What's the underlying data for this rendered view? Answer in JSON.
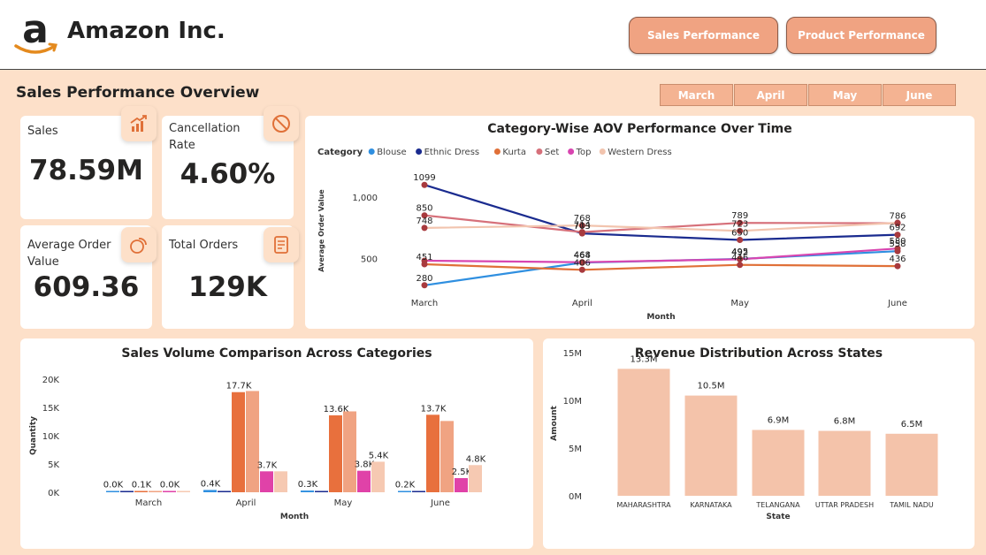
{
  "header": {
    "brand": "Amazon Inc.",
    "logo_icon": "amazon-a-logo",
    "nav": [
      "Sales Performance",
      "Product Performance"
    ]
  },
  "page": {
    "title": "Sales Performance Overview",
    "months": [
      "March",
      "April",
      "May",
      "June"
    ]
  },
  "kpis": [
    {
      "label": "Sales",
      "value": "78.59M",
      "icon": "growth-chart-icon"
    },
    {
      "label": "Cancellation Rate",
      "value": "4.60%",
      "icon": "prohibited-icon"
    },
    {
      "label": "Average Order Value",
      "value": "609.36",
      "icon": "coins-icon"
    },
    {
      "label": "Total Orders",
      "value": "129K",
      "icon": "receipt-icon"
    }
  ],
  "colors": {
    "Blouse": "#2f8fe0",
    "Ethnic Dress": "#1a2b8f",
    "Kurta": "#e07038",
    "Set": "#d6707a",
    "Top": "#d845b0",
    "Western Dress": "#f2c4ae",
    "point": "#a83a3e",
    "state_bar": "#f4c3aa",
    "vol_Kurta": "#e8703d",
    "vol_Set": "#f0a382",
    "vol_Top": "#e042a8",
    "vol_Western": "#f6c9b2"
  },
  "chart_data": [
    {
      "type": "line",
      "title": "Category-Wise AOV Performance Over Time",
      "legend_title": "Category",
      "legend_position": "top-left",
      "xlabel": "Month",
      "ylabel": "Average Order Value",
      "categories": [
        "March",
        "April",
        "May",
        "June"
      ],
      "ylim": [
        170,
        1180
      ],
      "yticks": [
        500,
        1000
      ],
      "ytick_labels": [
        "500",
        "1,000"
      ],
      "series": [
        {
          "name": "Blouse",
          "values": [
            280,
            464,
            495,
            558
          ]
        },
        {
          "name": "Ethnic Dress",
          "values": [
            1099,
            703,
            650,
            692
          ]
        },
        {
          "name": "Kurta",
          "values": [
            451,
            406,
            446,
            436
          ]
        },
        {
          "name": "Set",
          "values": [
            850,
            714,
            789,
            786
          ]
        },
        {
          "name": "Top",
          "values": [
            480,
            468,
            492,
            580
          ]
        },
        {
          "name": "Western Dress",
          "values": [
            748,
            768,
            723,
            790
          ]
        }
      ],
      "data_labels": [
        {
          "x": "March",
          "y": 1099,
          "text": "1099"
        },
        {
          "x": "March",
          "y": 748,
          "text": "748"
        },
        {
          "x": "March",
          "y": 850,
          "text": "850"
        },
        {
          "x": "March",
          "y": 451,
          "text": "451"
        },
        {
          "x": "March",
          "y": 280,
          "text": "280"
        },
        {
          "x": "April",
          "y": 714,
          "text": "714"
        },
        {
          "x": "April",
          "y": 703,
          "text": "703"
        },
        {
          "x": "April",
          "y": 768,
          "text": "768"
        },
        {
          "x": "April",
          "y": 468,
          "text": "468"
        },
        {
          "x": "April",
          "y": 464,
          "text": "464"
        },
        {
          "x": "April",
          "y": 406,
          "text": "406"
        },
        {
          "x": "May",
          "y": 789,
          "text": "789"
        },
        {
          "x": "May",
          "y": 723,
          "text": "723"
        },
        {
          "x": "May",
          "y": 495,
          "text": "495"
        },
        {
          "x": "May",
          "y": 650,
          "text": "650"
        },
        {
          "x": "May",
          "y": 492,
          "text": "492"
        },
        {
          "x": "May",
          "y": 446,
          "text": "446"
        },
        {
          "x": "June",
          "y": 786,
          "text": "786"
        },
        {
          "x": "June",
          "y": 692,
          "text": "692"
        },
        {
          "x": "June",
          "y": 558,
          "text": "558"
        },
        {
          "x": "June",
          "y": 580,
          "text": "580"
        },
        {
          "x": "June",
          "y": 436,
          "text": "436"
        }
      ]
    },
    {
      "type": "bar",
      "title": "Sales Volume Comparison Across Categories",
      "legend_title": "Category",
      "legend_position": "top-left",
      "xlabel": "Month",
      "ylabel": "Quantity",
      "categories": [
        "March",
        "April",
        "May",
        "June"
      ],
      "ylim": [
        0,
        20000
      ],
      "yticks": [
        0,
        5000,
        10000,
        15000,
        20000
      ],
      "ytick_labels": [
        "0K",
        "5K",
        "10K",
        "15K",
        "20K"
      ],
      "series": [
        {
          "name": "Blouse",
          "values": [
            0,
            400,
            300,
            200
          ],
          "labels": [
            "0.0K",
            "0.4K",
            "0.3K",
            "0.2K"
          ]
        },
        {
          "name": "Ethnic Dress",
          "values": [
            0,
            0,
            0,
            0
          ]
        },
        {
          "name": "Kurta",
          "values": [
            100,
            17700,
            13600,
            13700
          ],
          "labels": [
            "0.1K",
            "17.7K",
            "13.6K",
            "13.7K"
          ]
        },
        {
          "name": "Set",
          "values": [
            0,
            17900,
            14300,
            12600
          ]
        },
        {
          "name": "Top",
          "values": [
            0,
            3700,
            3800,
            2500
          ],
          "labels": [
            "0.0K",
            "3.7K",
            "3.8K",
            "2.5K"
          ]
        },
        {
          "name": "Western Dress",
          "values": [
            0,
            3700,
            5400,
            4800
          ],
          "labels": [
            "",
            "",
            "5.4K",
            "4.8K"
          ]
        }
      ]
    },
    {
      "type": "bar",
      "title": "Revenue Distribution Across States",
      "xlabel": "State",
      "ylabel": "Amount",
      "categories": [
        "MAHARASHTRA",
        "KARNATAKA",
        "TELANGANA",
        "UTTAR PRADESH",
        "TAMIL NADU"
      ],
      "values": [
        13300000,
        10500000,
        6900000,
        6800000,
        6500000
      ],
      "value_labels": [
        "13.3M",
        "10.5M",
        "6.9M",
        "6.8M",
        "6.5M"
      ],
      "ylim": [
        0,
        15000000
      ],
      "yticks": [
        0,
        5000000,
        10000000,
        15000000
      ],
      "ytick_labels": [
        "0M",
        "5M",
        "10M",
        "15M"
      ]
    }
  ]
}
